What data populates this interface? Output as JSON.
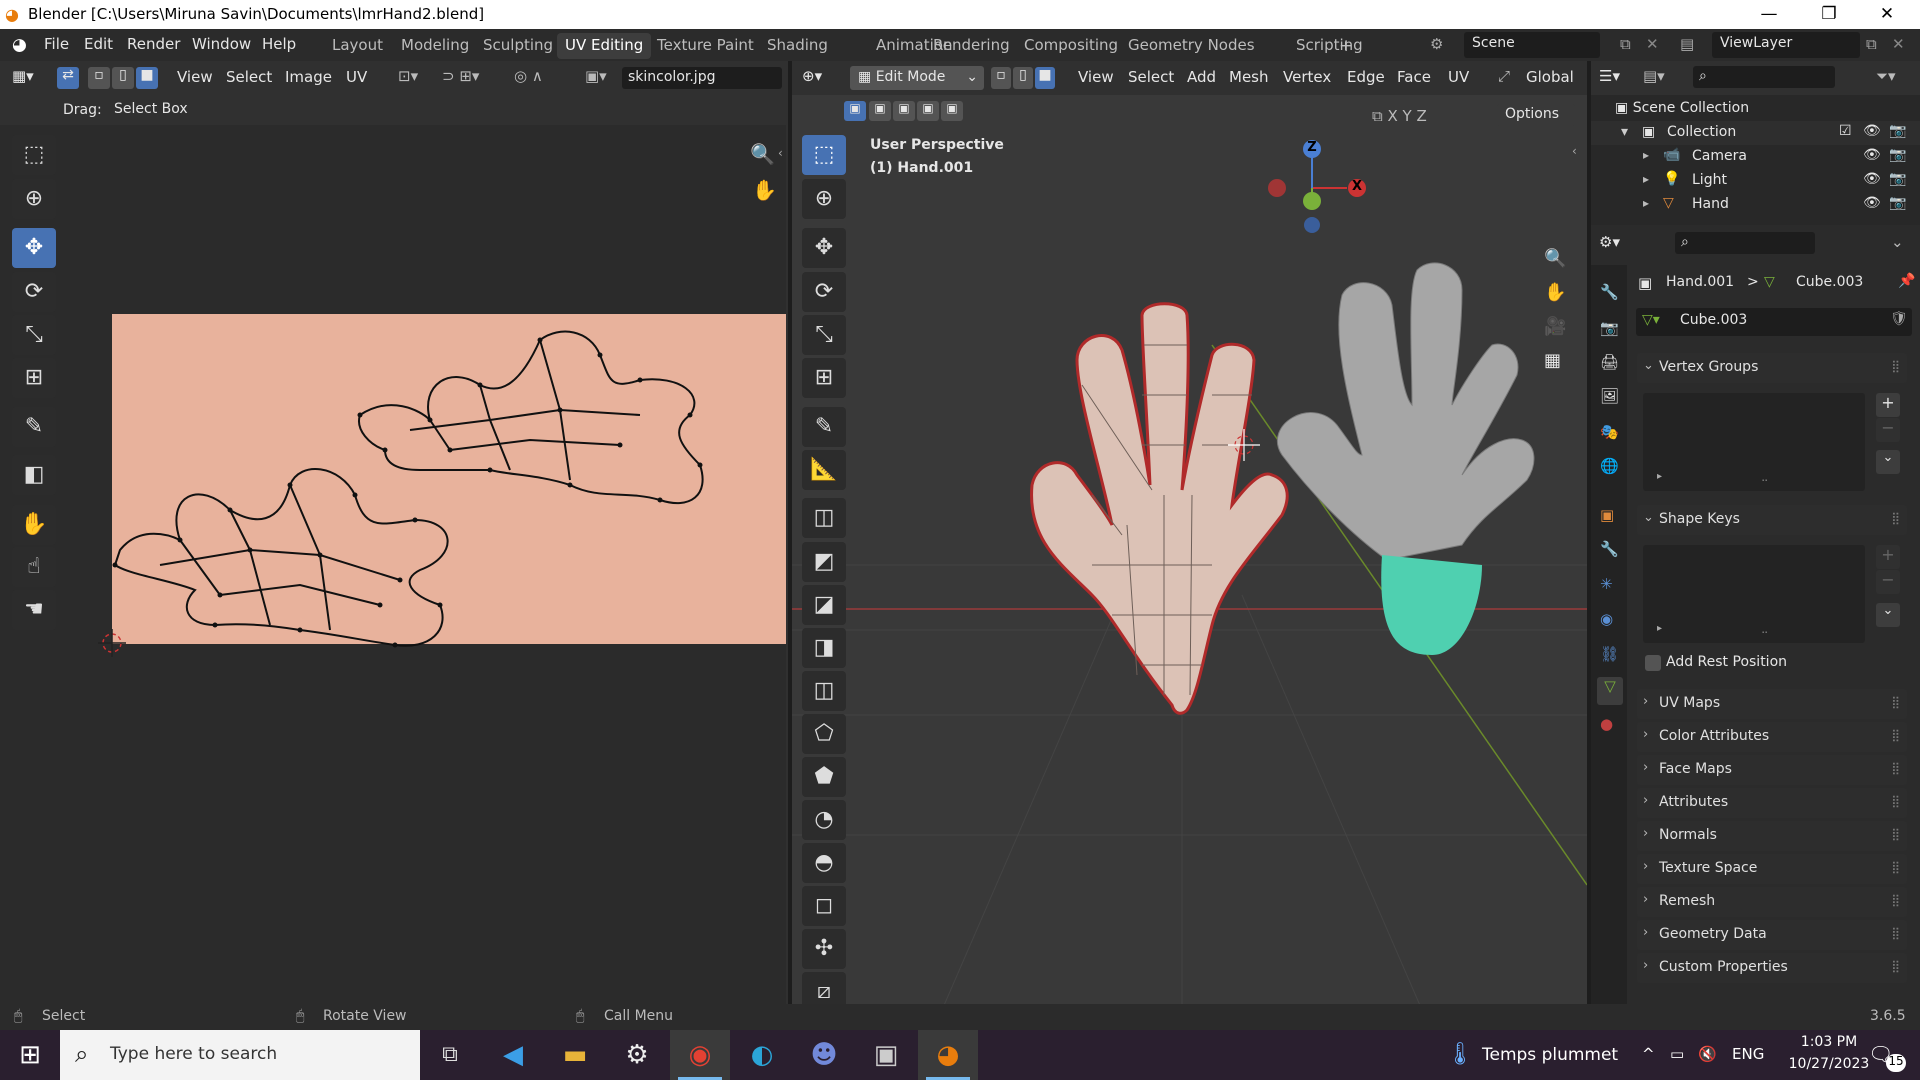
{
  "window": {
    "title": "Blender [C:\\Users\\Miruna Savin\\Documents\\lmrHand2.blend]",
    "minimize": "—",
    "maximize": "❐",
    "close": "✕"
  },
  "menu": {
    "file": "File",
    "edit": "Edit",
    "render": "Render",
    "window": "Window",
    "help": "Help"
  },
  "workspaces": [
    "Layout",
    "Modeling",
    "Sculpting",
    "UV Editing",
    "Texture Paint",
    "Shading",
    "Animation",
    "Rendering",
    "Compositing",
    "Geometry Nodes",
    "Scripting"
  ],
  "workspace_add": "+",
  "scene": {
    "name": "Scene",
    "view_layer": "ViewLayer"
  },
  "uv_editor": {
    "menus": [
      "View",
      "Select",
      "Image",
      "UV"
    ],
    "image_name": "skincolor.jpg",
    "drag_label": "Drag:",
    "drag_value": "Select Box",
    "image_color": "#e8b29c"
  },
  "viewport": {
    "mode": "Edit Mode",
    "menus": [
      "View",
      "Select",
      "Add",
      "Mesh",
      "Vertex",
      "Edge",
      "Face",
      "UV"
    ],
    "transform": "Global",
    "options": "Options",
    "axes": [
      "X",
      "Y",
      "Z"
    ],
    "overlay_title": "User Perspective",
    "overlay_object": "(1) Hand.001",
    "gizmo": {
      "z": "Z",
      "x": "X"
    },
    "hand_color": "#dcc2b6",
    "glove_color": "#a6a6a6",
    "cuff_color": "#4fd0b0"
  },
  "outliner": {
    "scene_collection": "Scene Collection",
    "items": [
      {
        "name": "Collection",
        "icon": "collection-icon"
      },
      {
        "name": "Camera",
        "icon": "camera-icon"
      },
      {
        "name": "Light",
        "icon": "light-icon"
      },
      {
        "name": "Hand",
        "icon": "mesh-icon"
      }
    ]
  },
  "properties": {
    "breadcrumb_object": "Hand.001",
    "breadcrumb_sep": ">",
    "breadcrumb_mesh": "Cube.003",
    "mesh_name": "Cube.003",
    "vertex_groups": "Vertex Groups",
    "shape_keys": "Shape Keys",
    "add_rest_position": "Add Rest Position",
    "sections": [
      "UV Maps",
      "Color Attributes",
      "Face Maps",
      "Attributes",
      "Normals",
      "Texture Space",
      "Remesh",
      "Geometry Data",
      "Custom Properties"
    ]
  },
  "statusbar": {
    "select": "Select",
    "rotate": "Rotate View",
    "call_menu": "Call Menu",
    "version": "3.6.5"
  },
  "taskbar": {
    "search_placeholder": "Type here to search",
    "weather": "Temps plummet",
    "lang": "ENG",
    "time": "1:03 PM",
    "date": "10/27/2023",
    "notifications": "15"
  }
}
